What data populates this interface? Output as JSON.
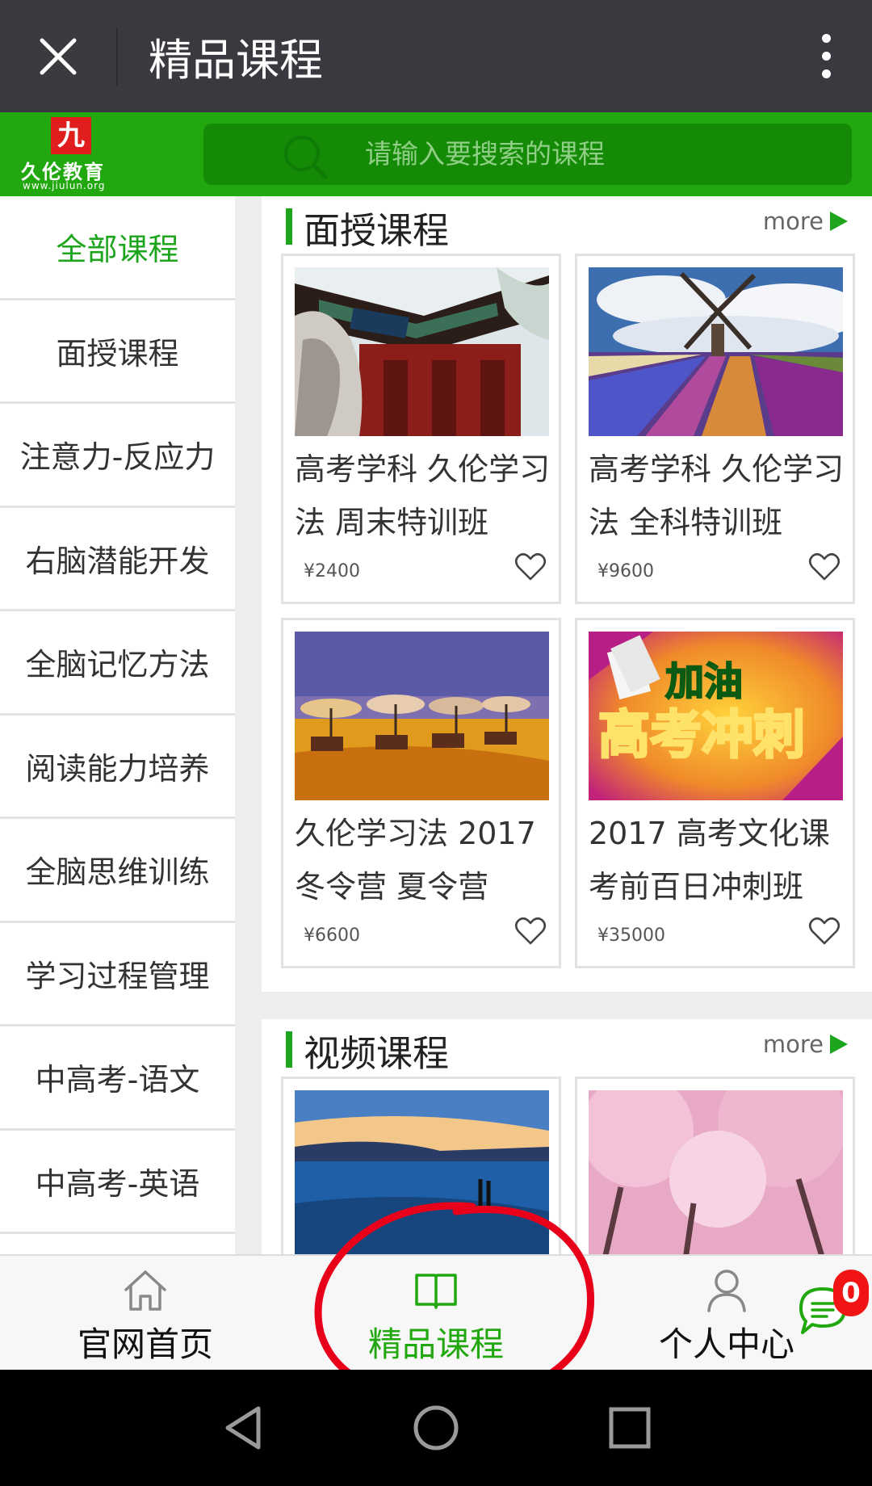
{
  "titlebar": {
    "title": "精品课程"
  },
  "header": {
    "logo_char": "九",
    "logo_name": "久伦教育",
    "logo_url": "www.jiulun.org",
    "search_placeholder": "请输入要搜索的课程"
  },
  "sidebar": {
    "items": [
      {
        "label": "全部课程",
        "active": true
      },
      {
        "label": "面授课程"
      },
      {
        "label": "注意力-反应力"
      },
      {
        "label": "右脑潜能开发"
      },
      {
        "label": "全脑记忆方法"
      },
      {
        "label": "阅读能力培养"
      },
      {
        "label": "全脑思维训练"
      },
      {
        "label": "学习过程管理"
      },
      {
        "label": "中高考-语文"
      },
      {
        "label": "中高考-英语"
      },
      {
        "label": ""
      }
    ]
  },
  "sections": [
    {
      "title": "面授课程",
      "more": "more",
      "cards": [
        {
          "title": "高考学科 久伦学习法 周末特训班",
          "price": "¥2400",
          "image": "university-gate"
        },
        {
          "title": "高考学科 久伦学习法 全科特训班",
          "price": "¥9600",
          "image": "windmill-tulips"
        },
        {
          "title": "久伦学习法 2017 冬令营 夏令营",
          "price": "¥6600",
          "image": "beach-umbrellas"
        },
        {
          "title": "2017 高考文化课 考前百日冲刺班",
          "price": "¥35000",
          "image": "exam-sprint-poster",
          "poster_text_1": "加油",
          "poster_text_2": "高考冲刺"
        }
      ]
    },
    {
      "title": "视频课程",
      "more": "more",
      "cards": [
        {
          "image": "sea-sunset"
        },
        {
          "image": "cherry-blossoms"
        }
      ]
    }
  ],
  "bottom_nav": {
    "items": [
      {
        "label": "官网首页",
        "icon": "home-icon"
      },
      {
        "label": "精品课程",
        "icon": "book-icon",
        "active": true
      },
      {
        "label": "个人中心",
        "icon": "person-icon"
      }
    ],
    "chat_badge": "0"
  },
  "colors": {
    "accent": "#20a80e",
    "titlebar": "#393a3f",
    "annotation": "#e8001a"
  }
}
